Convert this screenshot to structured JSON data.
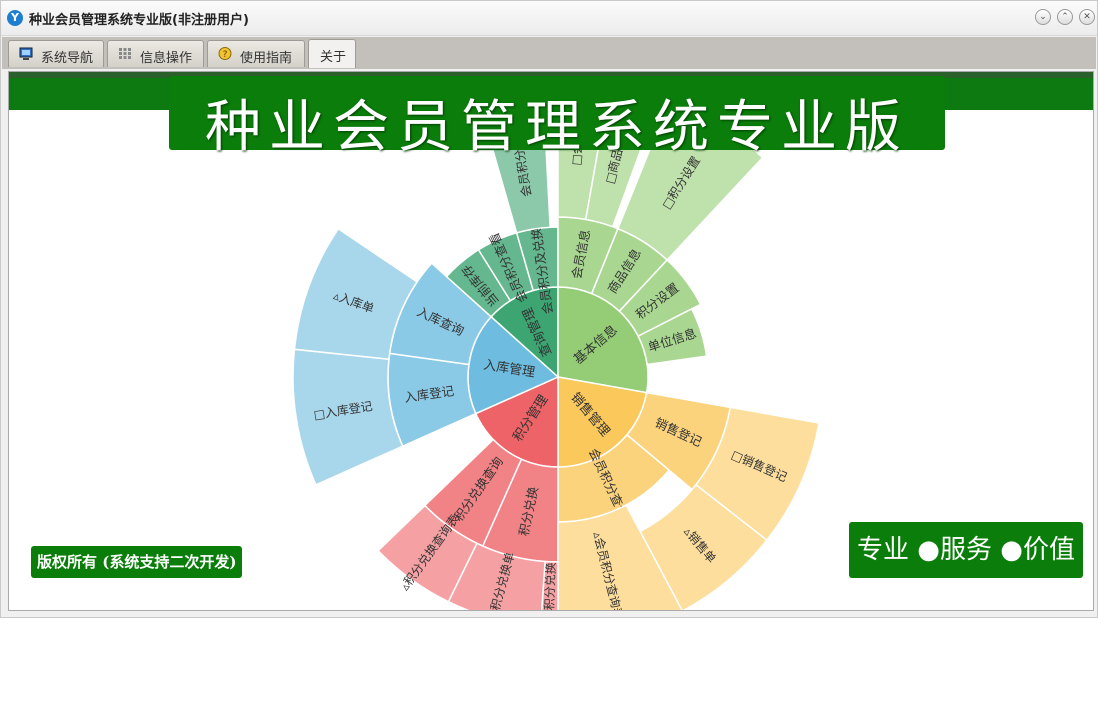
{
  "window": {
    "title": "种业会员管理系统专业版(非注册用户)",
    "buttons": [
      "⌄",
      "⌃",
      "✕"
    ]
  },
  "tabs": [
    {
      "label": "系统导航",
      "icon": "monitor-icon"
    },
    {
      "label": "信息操作",
      "icon": "grid-icon"
    },
    {
      "label": "使用指南",
      "icon": "help-icon"
    },
    {
      "label": "关于",
      "icon": ""
    }
  ],
  "banner": {
    "title": "种业会员管理系统专业版"
  },
  "copyright": "版权所有 (系统支持二次开发)",
  "slogan": "专业 ●服务 ●价值",
  "colors": {
    "brand_green": "#0a7d0a",
    "query": "#3da572",
    "basic": "#94cd75",
    "sales": "#fbc85c",
    "points": "#ee6367",
    "stock": "#6ebde0"
  },
  "sunburst": {
    "inner": [
      {
        "label": "查询管理"
      },
      {
        "label": "基本信息"
      },
      {
        "label": "销售管理"
      },
      {
        "label": "积分管理"
      },
      {
        "label": "入库管理"
      }
    ],
    "middle": [
      {
        "label": "当前库存"
      },
      {
        "label": "会员积分查看"
      },
      {
        "label": "会员积分及兑换明细"
      },
      {
        "label": "会员信息"
      },
      {
        "label": "商品信息"
      },
      {
        "label": "积分设置"
      },
      {
        "label": "单位信息"
      },
      {
        "label": "销售登记"
      },
      {
        "label": "会员积分查询"
      },
      {
        "label": "积分兑换"
      },
      {
        "label": "积分兑换查询"
      },
      {
        "label": "入库登记"
      },
      {
        "label": "入库查询"
      }
    ],
    "outer": [
      {
        "label": "会员积分对账表"
      },
      {
        "label": "□会员"
      },
      {
        "label": "□商品信息"
      },
      {
        "label": "□积分设置"
      },
      {
        "label": "□销售登记"
      },
      {
        "label": "▵销售单"
      },
      {
        "label": "▵会员积分查询表"
      },
      {
        "label": "□积分兑换"
      },
      {
        "label": "□积分兑换单"
      },
      {
        "label": "▵积分兑换查询表"
      },
      {
        "label": "□入库登记"
      },
      {
        "label": "▵入库单"
      }
    ]
  }
}
